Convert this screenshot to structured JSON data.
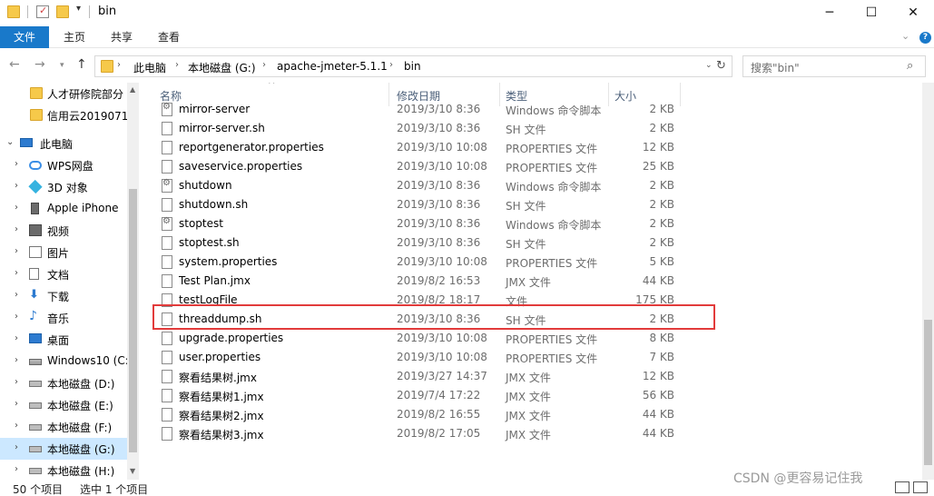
{
  "window": {
    "title": "bin",
    "minimize": "─",
    "maximize": "☐",
    "close": "✕"
  },
  "ribbon": {
    "tabs": [
      "文件",
      "主页",
      "共享",
      "查看"
    ],
    "expand": "⌄",
    "help": "?"
  },
  "address": {
    "crumbs": [
      "此电脑",
      "本地磁盘 (G:)",
      "apache-jmeter-5.1.1",
      "bin"
    ],
    "search_placeholder": "搜索\"bin\""
  },
  "navpane": {
    "items": [
      {
        "label": "人才研修院部分",
        "icon": "folder-icon"
      },
      {
        "label": "信用云2019071",
        "icon": "folder-icon"
      },
      {
        "label": "此电脑",
        "icon": "computer-icon"
      },
      {
        "label": "WPS网盘",
        "icon": "cloud-icon"
      },
      {
        "label": "3D 对象",
        "icon": "cube-icon"
      },
      {
        "label": "Apple iPhone",
        "icon": "phone-icon"
      },
      {
        "label": "视频",
        "icon": "video-icon"
      },
      {
        "label": "图片",
        "icon": "pictures-icon"
      },
      {
        "label": "文档",
        "icon": "documents-icon"
      },
      {
        "label": "下载",
        "icon": "download-icon"
      },
      {
        "label": "音乐",
        "icon": "music-icon"
      },
      {
        "label": "桌面",
        "icon": "desktop-icon"
      },
      {
        "label": "Windows10 (C:",
        "icon": "windows-drive-icon"
      },
      {
        "label": "本地磁盘 (D:)",
        "icon": "drive-icon"
      },
      {
        "label": "本地磁盘 (E:)",
        "icon": "drive-icon"
      },
      {
        "label": "本地磁盘 (F:)",
        "icon": "drive-icon"
      },
      {
        "label": "本地磁盘 (G:)",
        "icon": "drive-icon"
      },
      {
        "label": "本地磁盘 (H:)",
        "icon": "drive-icon"
      }
    ]
  },
  "columns": {
    "name": "名称",
    "date": "修改日期",
    "type": "类型",
    "size": "大小"
  },
  "files": [
    {
      "name": "mirror-server",
      "date": "2019/3/10 8:36",
      "type": "Windows 命令脚本",
      "size": "2 KB",
      "icon": "script-icon"
    },
    {
      "name": "mirror-server.sh",
      "date": "2019/3/10 8:36",
      "type": "SH 文件",
      "size": "2 KB",
      "icon": "file-icon"
    },
    {
      "name": "reportgenerator.properties",
      "date": "2019/3/10 10:08",
      "type": "PROPERTIES 文件",
      "size": "12 KB",
      "icon": "file-icon"
    },
    {
      "name": "saveservice.properties",
      "date": "2019/3/10 10:08",
      "type": "PROPERTIES 文件",
      "size": "25 KB",
      "icon": "file-icon"
    },
    {
      "name": "shutdown",
      "date": "2019/3/10 8:36",
      "type": "Windows 命令脚本",
      "size": "2 KB",
      "icon": "script-icon"
    },
    {
      "name": "shutdown.sh",
      "date": "2019/3/10 8:36",
      "type": "SH 文件",
      "size": "2 KB",
      "icon": "file-icon"
    },
    {
      "name": "stoptest",
      "date": "2019/3/10 8:36",
      "type": "Windows 命令脚本",
      "size": "2 KB",
      "icon": "script-icon"
    },
    {
      "name": "stoptest.sh",
      "date": "2019/3/10 8:36",
      "type": "SH 文件",
      "size": "2 KB",
      "icon": "file-icon"
    },
    {
      "name": "system.properties",
      "date": "2019/3/10 10:08",
      "type": "PROPERTIES 文件",
      "size": "5 KB",
      "icon": "file-icon"
    },
    {
      "name": "Test Plan.jmx",
      "date": "2019/8/2 16:53",
      "type": "JMX 文件",
      "size": "44 KB",
      "icon": "file-icon"
    },
    {
      "name": "testLogFile",
      "date": "2019/8/2 18:17",
      "type": "文件",
      "size": "175 KB",
      "icon": "file-icon"
    },
    {
      "name": "threaddump.sh",
      "date": "2019/3/10 8:36",
      "type": "SH 文件",
      "size": "2 KB",
      "icon": "file-icon"
    },
    {
      "name": "upgrade.properties",
      "date": "2019/3/10 10:08",
      "type": "PROPERTIES 文件",
      "size": "8 KB",
      "icon": "file-icon"
    },
    {
      "name": "user.properties",
      "date": "2019/3/10 10:08",
      "type": "PROPERTIES 文件",
      "size": "7 KB",
      "icon": "file-icon"
    },
    {
      "name": "察看结果树.jmx",
      "date": "2019/3/27 14:37",
      "type": "JMX 文件",
      "size": "12 KB",
      "icon": "file-icon"
    },
    {
      "name": "察看结果树1.jmx",
      "date": "2019/7/4 17:22",
      "type": "JMX 文件",
      "size": "56 KB",
      "icon": "file-icon"
    },
    {
      "name": "察看结果树2.jmx",
      "date": "2019/8/2 16:55",
      "type": "JMX 文件",
      "size": "44 KB",
      "icon": "file-icon"
    },
    {
      "name": "察看结果树3.jmx",
      "date": "2019/8/2 17:05",
      "type": "JMX 文件",
      "size": "44 KB",
      "icon": "file-icon"
    }
  ],
  "status": {
    "count": "50 个项目",
    "selected": "选中 1 个项目",
    "watermark": "CSDN @更容易记住我"
  },
  "colors": {
    "accent": "#1979ca",
    "selection": "#cce8ff",
    "highlight_box": "#e23b3b"
  }
}
